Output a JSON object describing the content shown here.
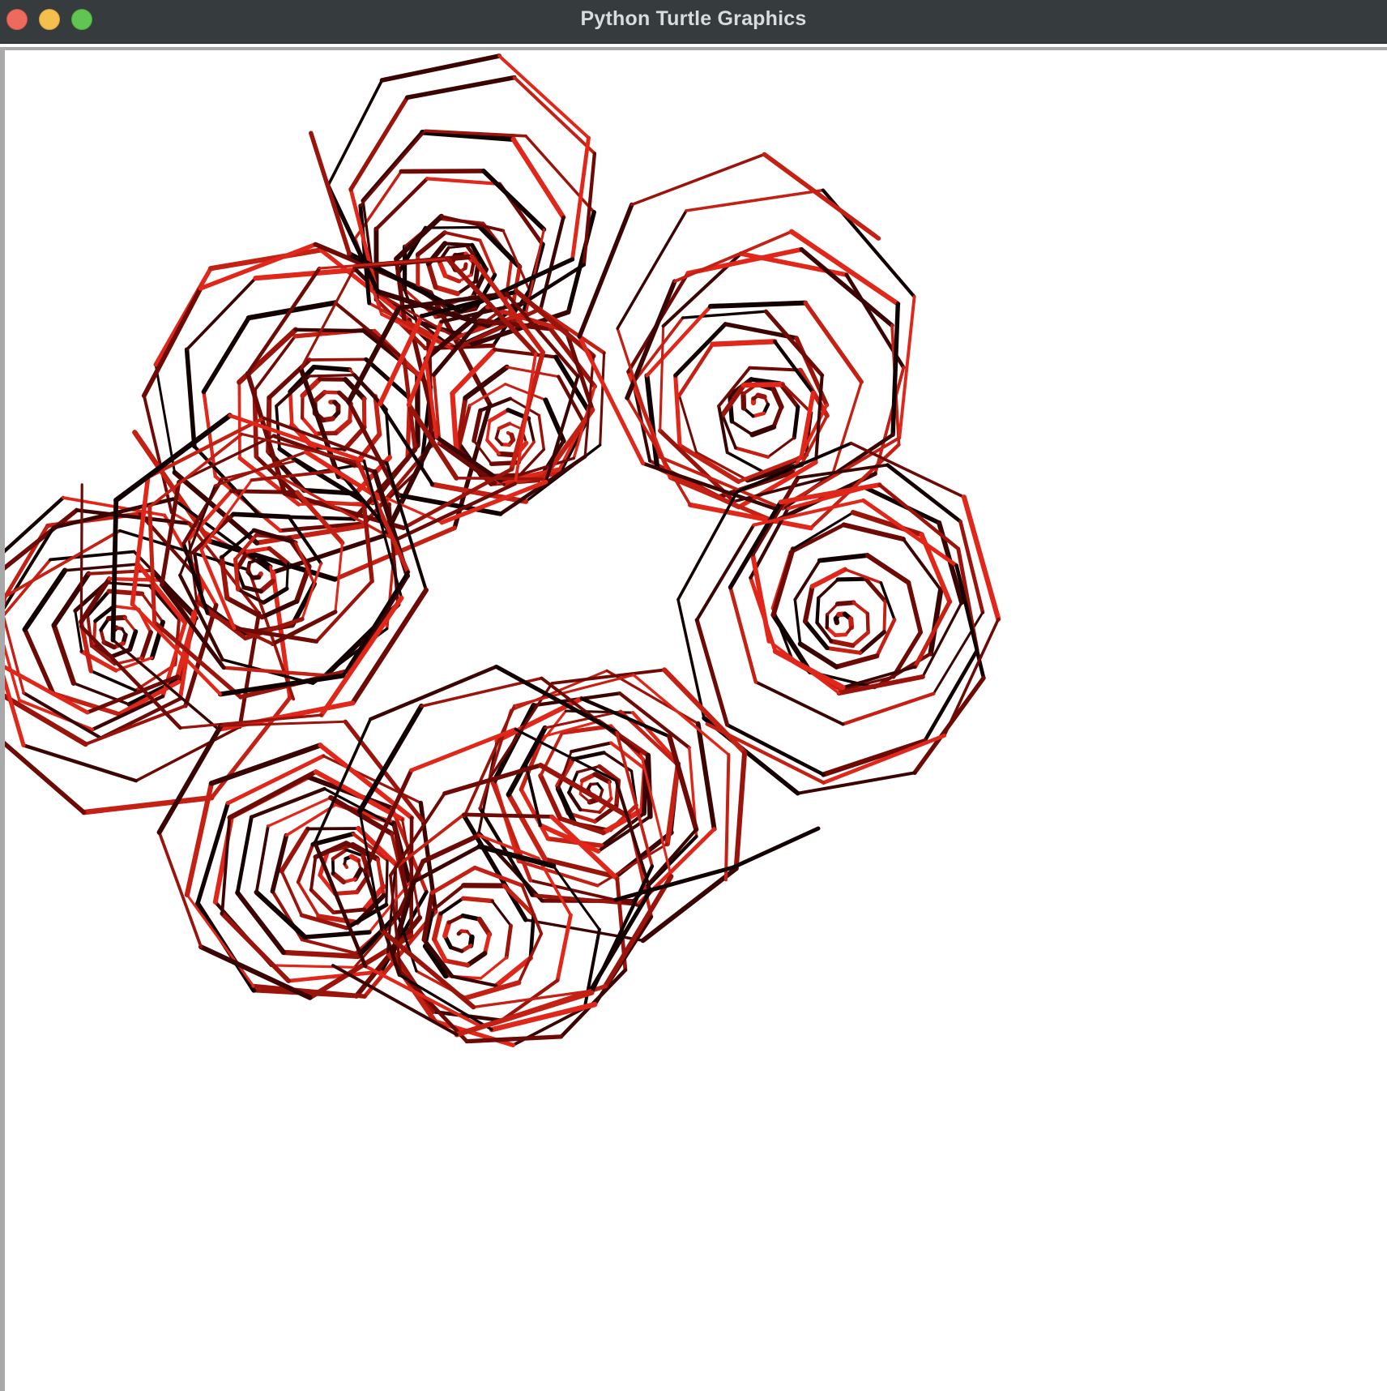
{
  "window": {
    "title": "Python Turtle Graphics",
    "controls": [
      {
        "name": "close",
        "color": "#ec6a5e"
      },
      {
        "name": "minimize",
        "color": "#f4bf4f"
      },
      {
        "name": "zoom",
        "color": "#61c554"
      }
    ]
  },
  "canvas": {
    "background": "#ffffff",
    "stroke_palette": [
      "#e0271a",
      "#c42014",
      "#9a140c",
      "#6e0a06",
      "#3a0403",
      "#120000"
    ]
  }
}
